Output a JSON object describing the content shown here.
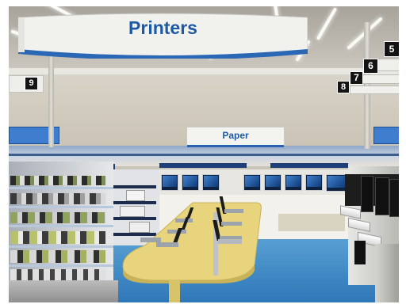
{
  "signs": {
    "printers": "Printers",
    "paper": "Paper"
  },
  "markers": {
    "m5": "5",
    "m6": "6",
    "m7": "7",
    "m8": "8",
    "m9": "9"
  },
  "colors": {
    "brand_blue": "#1d5aa6",
    "floor_blue": "#3f87c6",
    "table_yellow": "#e6d27a"
  }
}
